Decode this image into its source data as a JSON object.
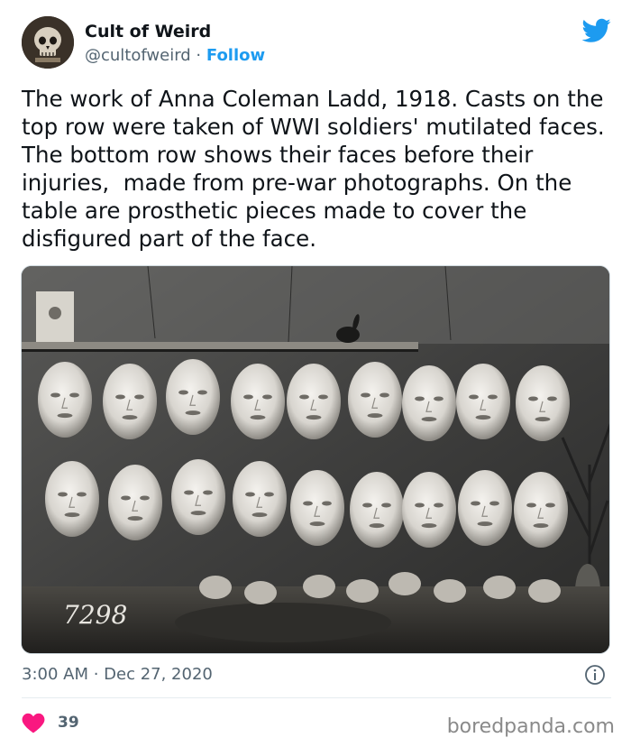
{
  "tweet": {
    "author_name": "Cult of Weird",
    "handle": "@cultofweird",
    "separator": " · ",
    "follow_label": "Follow",
    "text": "The work of Anna Coleman Ladd, 1918. Casts on the top row were taken of WWI soldiers' mutilated faces. The bottom row shows their faces before their injuries,  made from pre-war photographs. On the table are prosthetic pieces made to cover the disfigured part of the face.",
    "timestamp": "3:00 AM · Dec 27, 2020",
    "like_count": "39",
    "photo_caption_number": "7298"
  },
  "colors": {
    "accent": "#1d9bf0",
    "like": "#f91880",
    "muted": "#536471"
  },
  "icons": [
    "twitter-logo-icon",
    "info-icon",
    "heart-icon",
    "skull-avatar"
  ],
  "watermark": "boredpanda.com"
}
